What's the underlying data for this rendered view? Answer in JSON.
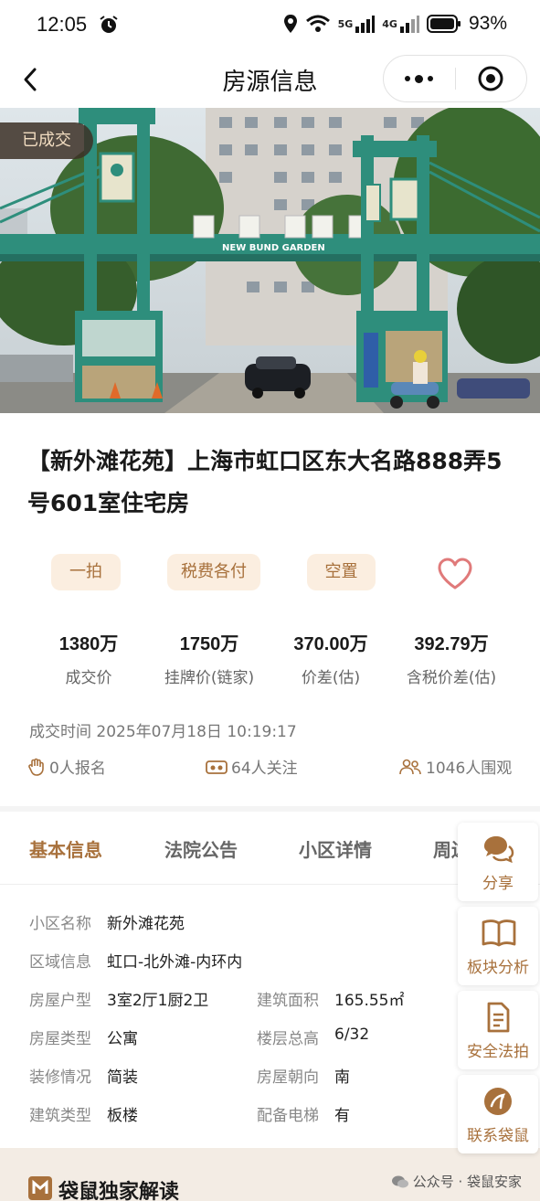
{
  "status_bar": {
    "time": "12:05",
    "net_5g": "5G",
    "net_4g": "4G",
    "battery": "93%"
  },
  "nav": {
    "title": "房源信息"
  },
  "hero": {
    "badge": "已成交",
    "sign_text": "NEW BUND GARDEN"
  },
  "house": {
    "title": "【新外滩花苑】上海市虹口区东大名路888弄5号601室住宅房"
  },
  "tags": [
    "一拍",
    "税费各付",
    "空置"
  ],
  "stats": [
    {
      "value": "1380万",
      "label": "成交价"
    },
    {
      "value": "1750万",
      "label": "挂牌价(链家)"
    },
    {
      "value": "370.00万",
      "label": "价差(估)"
    },
    {
      "value": "392.79万",
      "label": "含税价差(估)"
    }
  ],
  "deal_time": "成交时间 2025年07月18日 10:19:17",
  "counters": {
    "signups": "0人报名",
    "followers": "64人关注",
    "viewers": "1046人围观"
  },
  "tabs": [
    "基本信息",
    "法院公告",
    "小区详情",
    "周边"
  ],
  "basic_info": {
    "community": {
      "label": "小区名称",
      "value": "新外滩花苑"
    },
    "region": {
      "label": "区域信息",
      "value": "虹口-北外滩-内环内"
    },
    "layout": {
      "label": "房屋户型",
      "value": "3室2厅1厨2卫"
    },
    "area": {
      "label": "建筑面积",
      "value": "165.55㎡"
    },
    "house_type": {
      "label": "房屋类型",
      "value": "公寓"
    },
    "floor": {
      "label": "楼层总高",
      "value": "6/32"
    },
    "decoration": {
      "label": "装修情况",
      "value": "简装"
    },
    "orientation": {
      "label": "房屋朝向",
      "value": "南"
    },
    "building_type": {
      "label": "建筑类型",
      "value": "板楼"
    },
    "elevator": {
      "label": "配备电梯",
      "value": "有"
    }
  },
  "float_actions": [
    "分享",
    "板块分析",
    "安全法拍",
    "联系袋鼠"
  ],
  "bottom": {
    "heading": "袋鼠独家解读",
    "watermark": "公众号 · 袋鼠安家"
  },
  "colors": {
    "accent": "#a8713c",
    "tag_bg": "#fbeee0",
    "heart": "#e07a7a"
  }
}
